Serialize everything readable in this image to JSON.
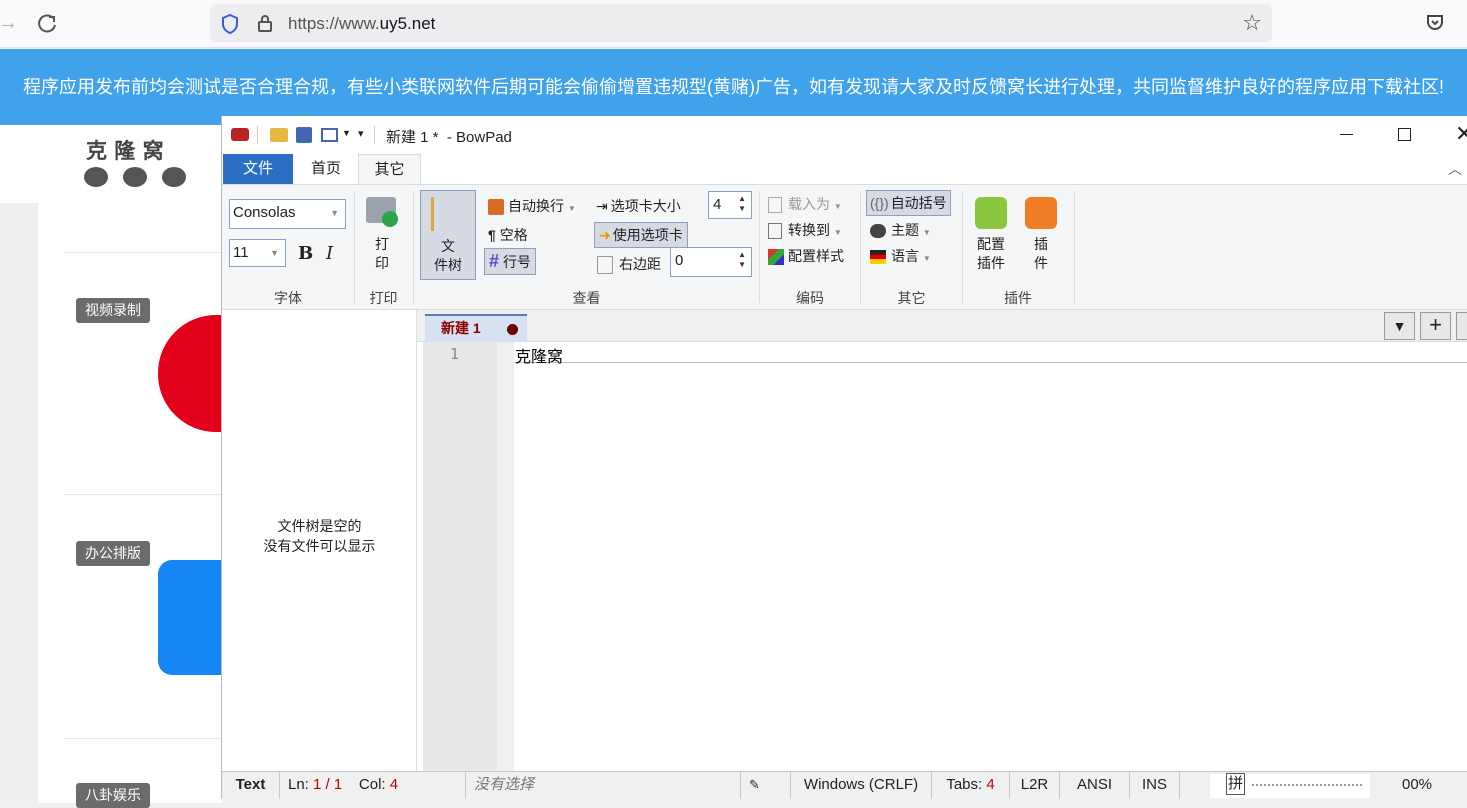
{
  "browser": {
    "url_prefix": "https://www.",
    "url_domain": "uy5.net"
  },
  "banner": {
    "text": "程序应用发布前均会测试是否合理合规，有些小类联网软件后期可能会偷偷增置违规型(黄赌)广告，如有发现请大家及时反馈窝长进行处理，共同监督维护良好的程序应用下载社区!"
  },
  "site": {
    "logo_text": "克 隆 窝",
    "categories": [
      "视频录制",
      "办公排版",
      "八卦娱乐"
    ]
  },
  "bowpad": {
    "title": "新建 1 *  - BowPad",
    "tabs": [
      "文件",
      "首页",
      "其它"
    ],
    "ribbon": {
      "font_name": "Consolas",
      "font_size": "11",
      "bold": "B",
      "italic": "I",
      "print_label": "打\n印",
      "filetree_label": "文\n件树",
      "word_wrap": "自动换行",
      "whitespace": "空格",
      "line_numbers": "行号",
      "tab_size_label": "选项卡大小",
      "tab_size_value": "4",
      "use_tabs": "使用选项卡",
      "right_margin_label": "右边距",
      "right_margin_value": "0",
      "load_as": "载入为",
      "convert_to": "转换到",
      "config_style": "配置样式",
      "auto_brace": "自动括号",
      "theme": "主题",
      "language": "语言",
      "config_plugins": "配置\n插件",
      "plugins": "插\n件",
      "groups": [
        "字体",
        "打印",
        "查看",
        "编码",
        "其它",
        "插件"
      ]
    },
    "filetree_message": [
      "文件树是空的",
      "没有文件可以显示"
    ],
    "doc_tab": "新建 1",
    "line_number": "1",
    "editor_text": "克隆窝",
    "status": {
      "lexer": "Text",
      "ln_label": "Ln:",
      "ln_value": "1 / 1",
      "col_label": "Col:",
      "col_value": "4",
      "selection": "没有选择",
      "eol": "Windows (CRLF)",
      "tabs_label": "Tabs:",
      "tabs_value": "4",
      "direction": "L2R",
      "encoding": "ANSI",
      "insert_mode": "INS",
      "zoom": "00%",
      "ime": "拼"
    }
  }
}
